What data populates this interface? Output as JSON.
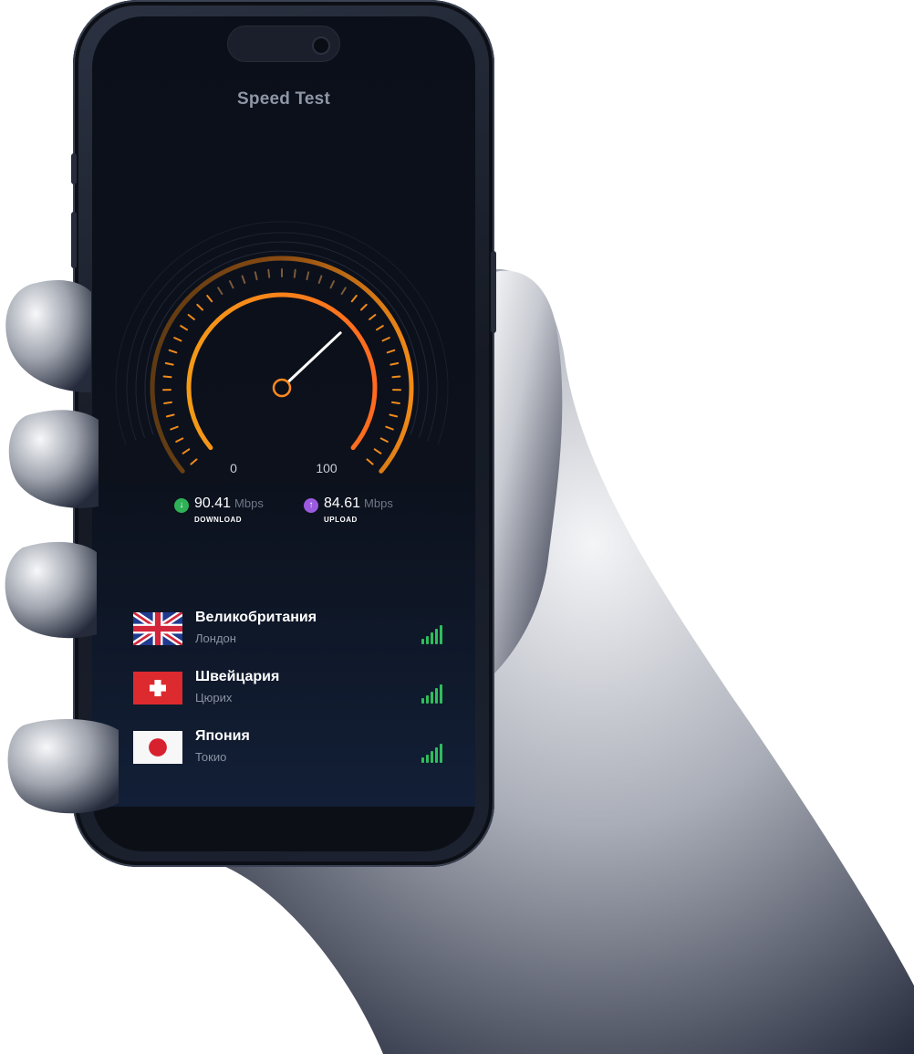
{
  "app": {
    "title": "Speed Test"
  },
  "gauge": {
    "scale_min": "0",
    "scale_max": "100",
    "needle_value": 68
  },
  "download": {
    "value": "90.41",
    "unit": "Mbps",
    "label": "DOWNLOAD",
    "icon": "arrow-down-icon",
    "color": "#2fb157"
  },
  "upload": {
    "value": "84.61",
    "unit": "Mbps",
    "label": "UPLOAD",
    "icon": "arrow-up-icon",
    "color": "#9a5be0"
  },
  "servers": [
    {
      "country": "Великобритания",
      "city": "Лондон",
      "flag": "uk-flag-icon",
      "signal_bars": 5
    },
    {
      "country": "Швейцария",
      "city": "Цюрих",
      "flag": "switzerland-flag-icon",
      "signal_bars": 5
    },
    {
      "country": "Япония",
      "city": "Токио",
      "flag": "japan-flag-icon",
      "signal_bars": 5
    }
  ],
  "colors": {
    "accent": "#ff8a1f",
    "signal": "#2fbe5c",
    "background": "#0b0f19"
  }
}
